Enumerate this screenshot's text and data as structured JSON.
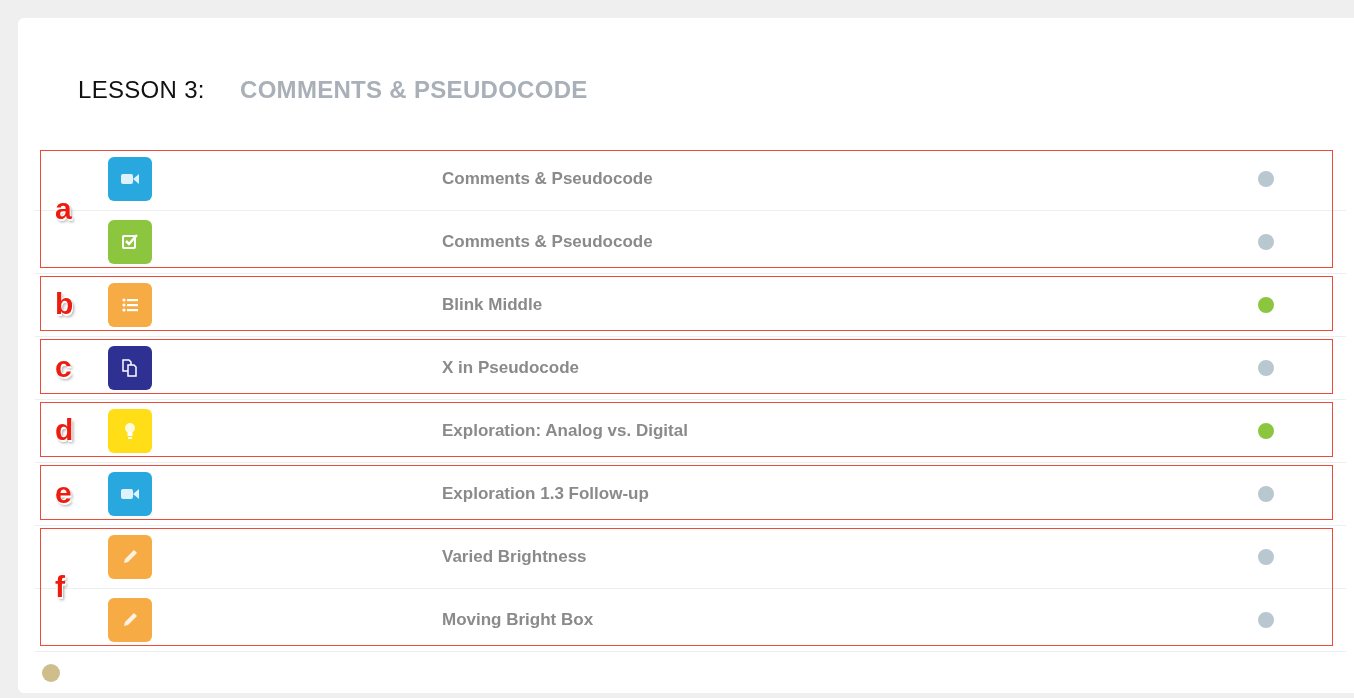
{
  "lesson": {
    "label": "LESSON 3:",
    "title": "COMMENTS & PSEUDOCODE"
  },
  "groups": [
    {
      "letter": "a",
      "items": [
        {
          "kind": "video",
          "title": "Comments & Pseudocode",
          "color": "#b9c7d0"
        },
        {
          "kind": "check",
          "title": "Comments & Pseudocode",
          "color": "#b9c7d0"
        }
      ]
    },
    {
      "letter": "b",
      "items": [
        {
          "kind": "list",
          "title": "Blink Middle",
          "color": "#8cc63f"
        }
      ]
    },
    {
      "letter": "c",
      "items": [
        {
          "kind": "copy",
          "title": "X in Pseudocode",
          "color": "#b9c7d0"
        }
      ]
    },
    {
      "letter": "d",
      "items": [
        {
          "kind": "bulb",
          "title": "Exploration: Analog vs. Digital",
          "color": "#8cc63f"
        }
      ]
    },
    {
      "letter": "e",
      "items": [
        {
          "kind": "video",
          "title": "Exploration 1.3 Follow-up",
          "color": "#b9c7d0"
        }
      ]
    },
    {
      "letter": "f",
      "items": [
        {
          "kind": "pencil",
          "title": "Varied Brightness",
          "color": "#b9c7d0"
        },
        {
          "kind": "pencil",
          "title": "Moving Bright Box",
          "color": "#b9c7d0"
        }
      ]
    }
  ]
}
